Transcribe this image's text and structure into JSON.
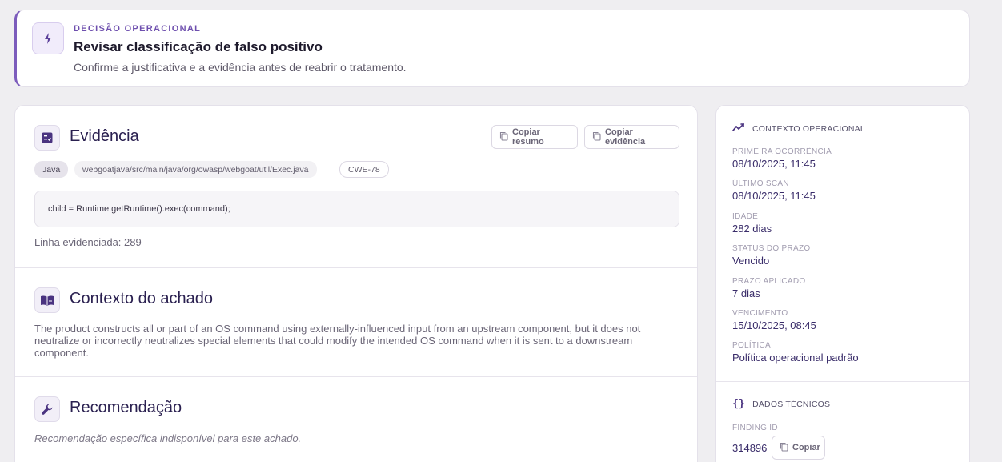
{
  "banner": {
    "kicker": "DECISÃO OPERACIONAL",
    "title": "Revisar classificação de falso positivo",
    "subtitle": "Confirme a justificativa e a evidência antes de reabrir o tratamento.",
    "icon": "lightning-icon"
  },
  "evidence": {
    "title": "Evidência",
    "icon": "checklist-icon",
    "copy_summary_label": "Copiar resumo",
    "copy_evidence_label": "Copiar evidência",
    "language": "Java",
    "file_path": "webgoatjava/src/main/java/org/owasp/webgoat/util/Exec.java",
    "cwe": "CWE-78",
    "code": "child = Runtime.getRuntime().exec(command);",
    "line_text": "Linha evidenciada: 289"
  },
  "context": {
    "title": "Contexto do achado",
    "icon": "book-icon",
    "description": "The product constructs all or part of an OS command using externally-influenced input from an upstream component, but it does not neutralize or incorrectly neutralizes special elements that could modify the intended OS command when it is sent to a downstream component."
  },
  "recommendation": {
    "title": "Recomendação",
    "icon": "wrench-icon",
    "text": "Recomendação específica indisponível para este achado."
  },
  "side": {
    "operational_title": "CONTEXTO OPERACIONAL",
    "operational_icon": "trend-icon",
    "fields": [
      {
        "label": "PRIMEIRA OCORRÊNCIA",
        "value": "08/10/2025, 11:45"
      },
      {
        "label": "ÚLTIMO SCAN",
        "value": "08/10/2025, 11:45"
      },
      {
        "label": "IDADE",
        "value": "282 dias"
      },
      {
        "label": "STATUS DO PRAZO",
        "value": "Vencido"
      },
      {
        "label": "PRAZO APLICADO",
        "value": "7 dias"
      },
      {
        "label": "VENCIMENTO",
        "value": "15/10/2025, 08:45"
      },
      {
        "label": "POLÍTICA",
        "value": "Política operacional padrão"
      }
    ],
    "technical_title": "DADOS TÉCNICOS",
    "technical_icon": "braces-icon",
    "finding_id_label": "FINDING ID",
    "finding_id_value": "314896",
    "copy_label": "Copiar"
  },
  "colors": {
    "accent": "#7c5cbc",
    "accent_dark": "#2a2050",
    "background": "#efeef1"
  }
}
